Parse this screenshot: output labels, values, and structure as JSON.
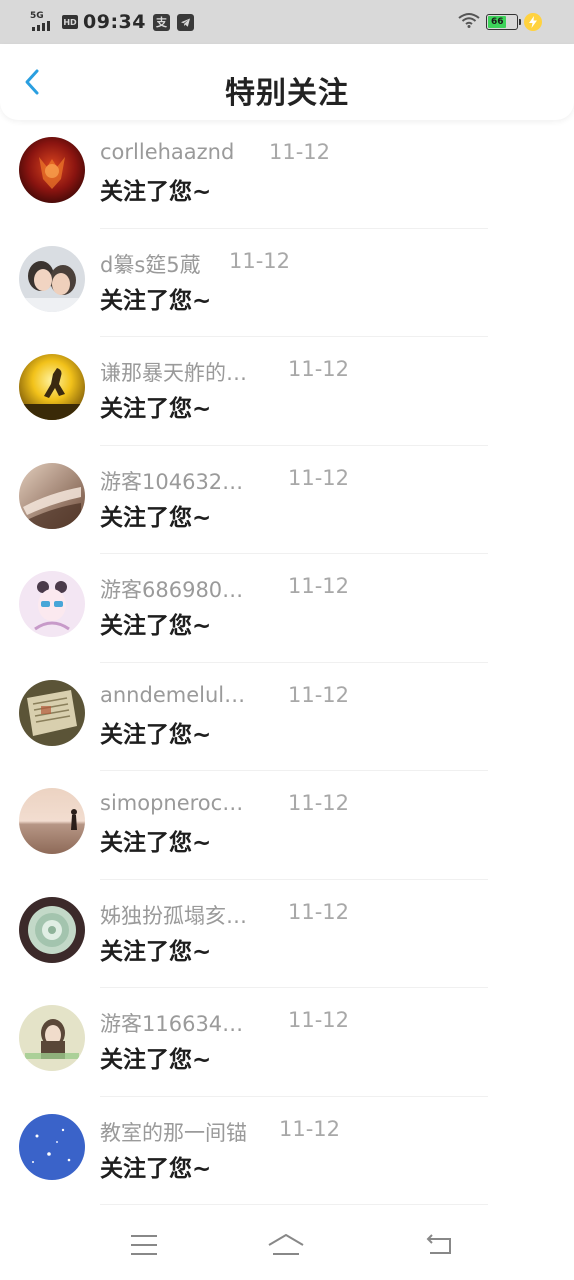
{
  "status_bar": {
    "network": "5G",
    "hd": "HD",
    "time": "09:34",
    "app_icon_text": "支",
    "battery_level": "66",
    "charging": true
  },
  "header": {
    "title": "特别关注",
    "back_icon": "chevron-left-icon",
    "accent_color": "#2a9fe0"
  },
  "notifications": [
    {
      "name": "corllehaaznd",
      "date": "11-12",
      "message": "关注了您~"
    },
    {
      "name": "d纂s筵5蕆",
      "date": "11-12",
      "message": "关注了您~"
    },
    {
      "name": "谦那暴天舴的…",
      "date": "11-12",
      "message": "关注了您~"
    },
    {
      "name": "游客104632…",
      "date": "11-12",
      "message": "关注了您~"
    },
    {
      "name": "游客686980…",
      "date": "11-12",
      "message": "关注了您~"
    },
    {
      "name": "anndemelul…",
      "date": "11-12",
      "message": "关注了您~"
    },
    {
      "name": "simopneroc…",
      "date": "11-12",
      "message": "关注了您~"
    },
    {
      "name": "姊独扮孤塌亥…",
      "date": "11-12",
      "message": "关注了您~"
    },
    {
      "name": "游客116634…",
      "date": "11-12",
      "message": "关注了您~"
    },
    {
      "name": "教室的那一间锚",
      "date": "11-12",
      "message": "关注了您~"
    }
  ],
  "nav_bar": {
    "menu_icon": "menu-icon",
    "home_icon": "home-icon",
    "back_icon": "back-arrow-icon"
  }
}
